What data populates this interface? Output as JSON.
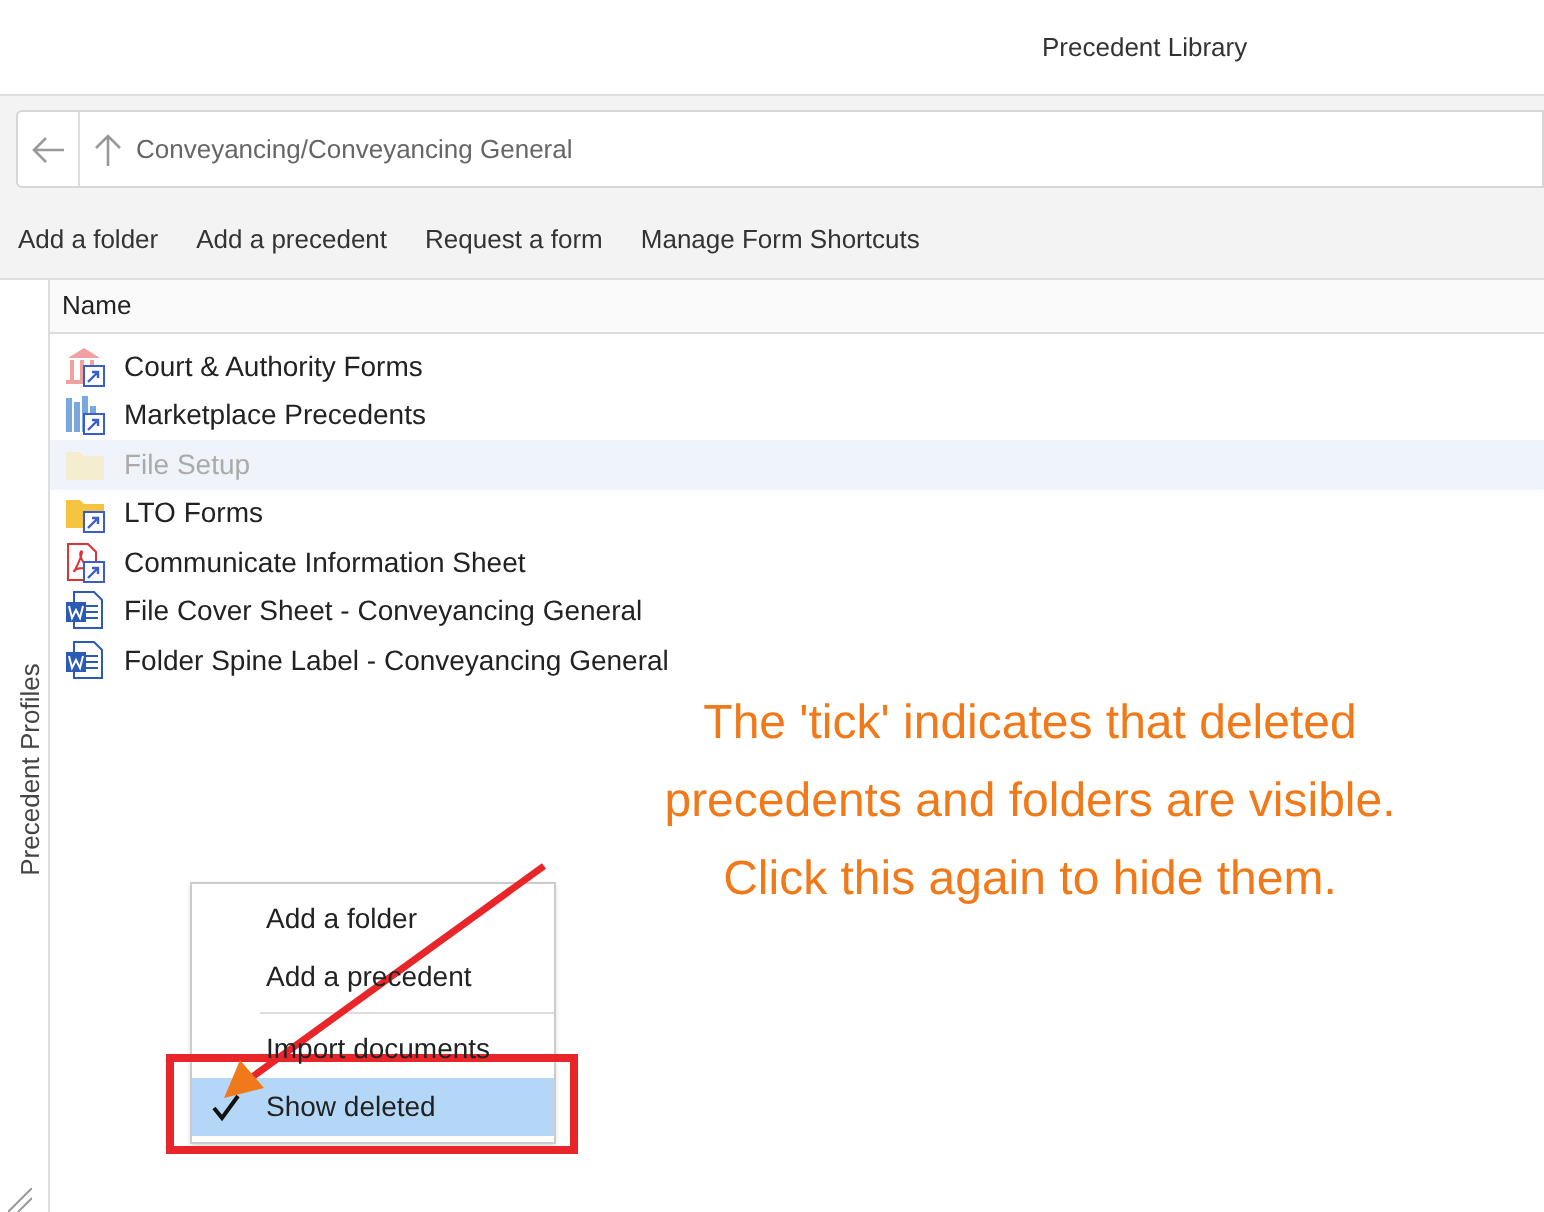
{
  "window": {
    "title": "Precedent Library"
  },
  "address_bar": {
    "path": "Conveyancing/Conveyancing General"
  },
  "toolbar": [
    "Add a folder",
    "Add a precedent",
    "Request a form",
    "Manage Form Shortcuts"
  ],
  "side_panel": {
    "label": "Precedent Profiles"
  },
  "list": {
    "column": "Name",
    "rows": [
      {
        "kind": "court",
        "label": "Court & Authority Forms",
        "deleted": false
      },
      {
        "kind": "marketplace",
        "label": "Marketplace Precedents",
        "deleted": false
      },
      {
        "kind": "folder",
        "label": "File Setup",
        "deleted": true
      },
      {
        "kind": "folder-shortcut",
        "label": "LTO Forms",
        "deleted": false
      },
      {
        "kind": "pdf",
        "label": "Communicate Information Sheet",
        "deleted": false
      },
      {
        "kind": "word",
        "label": "File Cover Sheet - Conveyancing General",
        "deleted": false
      },
      {
        "kind": "word",
        "label": "Folder Spine Label - Conveyancing General",
        "deleted": false
      }
    ]
  },
  "context_menu": [
    {
      "label": "Add a folder",
      "checked": false,
      "selected": false,
      "divider_before": false
    },
    {
      "label": "Add a precedent",
      "checked": false,
      "selected": false,
      "divider_before": false
    },
    {
      "label": "Import documents",
      "checked": false,
      "selected": false,
      "divider_before": true
    },
    {
      "label": "Show deleted",
      "checked": true,
      "selected": true,
      "divider_before": false
    }
  ],
  "annotation": {
    "lines": [
      "The 'tick' indicates that deleted",
      "precedents and folders are visible.",
      "Click this again to hide them."
    ]
  }
}
